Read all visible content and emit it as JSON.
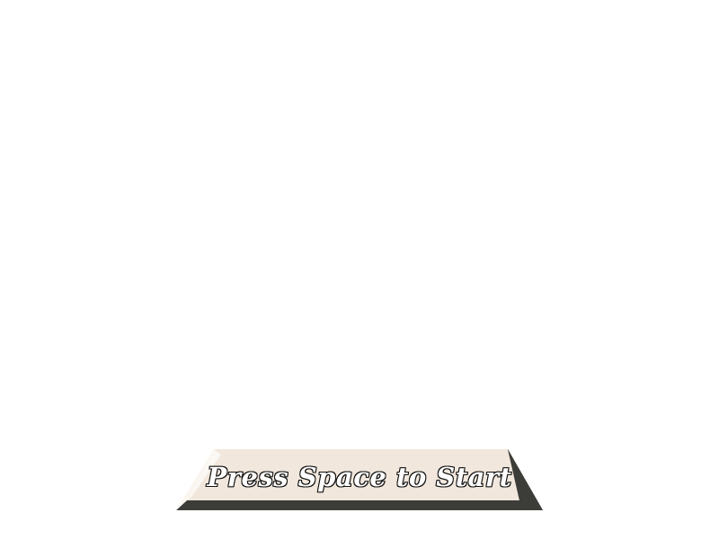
{
  "start_prompt": {
    "label": "Press Space to Start"
  },
  "colors": {
    "background": "#ffffff",
    "banner_face": "#f1e7dc",
    "banner_highlight": "#faf5ef",
    "banner_shadow": "#3c3c38",
    "text_fill": "#ffffff",
    "text_outline": "#111111"
  }
}
